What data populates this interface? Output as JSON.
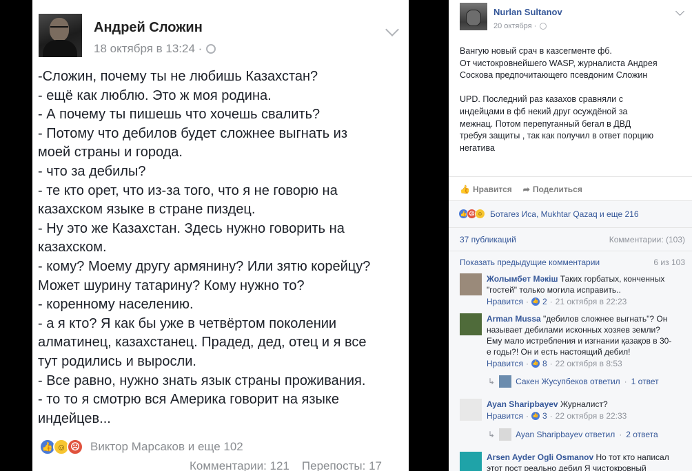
{
  "left_post": {
    "author": "Андрей Сложин",
    "timestamp": "18 октября в 13:24 ·",
    "lines": [
      "-Сложин, почему ты не любишь Казахстан?",
      "- ещё как люблю. Это ж моя родина.",
      "- А почему ты пишешь что хочешь свалить?",
      "- Потому что дебилов будет сложнее выгнать из",
      "моей страны и города.",
      "- что за дебилы?",
      "- те кто орет, что из-за того, что я не говорю на",
      "казахском языке в стране пиздец.",
      "- Ну это же Казахстан. Здесь нужно говорить на",
      "казахском.",
      "- кому? Моему другу армянину? Или зятю корейцу?",
      "Может шурину татарину? Кому нужно то?",
      "- коренному населению.",
      "- а я кто? Я как бы уже в четвёртом поколении",
      "алматинец, казахстанец. Прадед, дед, отец и я все",
      "тут родились и выросли.",
      "- Все равно, нужно знать язык страны проживания.",
      "- то то я смотрю вся Америка говорит на языке",
      "индейцев..."
    ],
    "reactions_text": "Виктор Марсаков и еще 102",
    "comments_text": "Комментарии: 121",
    "reposts_text": "Перепосты: 17"
  },
  "right_post": {
    "author": "Nurlan Sultanov",
    "timestamp": "20 октября ·",
    "text_lines": [
      "Вангую новый срач в казсегменте фб.",
      "От чистокровнейшего WASP, журналиста Андрея",
      "Соскова предпочитающего псевдоним Сложин",
      "",
      "UPD. Последний раз казахов сравняли с",
      "индейцами в фб некий друг осуждёной за",
      "межнац. Потом перепуганный бегал в ДВД",
      "требуя защиты , так как получил в ответ порцию",
      "негатива"
    ],
    "like_label": "Нравится",
    "share_label": "Поделиться",
    "reactions_text": "Ботагез Иса, Mukhtar Qazaq и еще 216",
    "shares_text": "37 публикаций",
    "comments_count_text": "Комментарии: (103)",
    "prev_comments_label": "Показать предыдущие комментарии",
    "pagination_text": "6 из 103",
    "comments": [
      {
        "author": "Жолымбет Мәкіш",
        "lines": [
          "Таких горбатых, конченных",
          "\"гостей\" только могила исправить.."
        ],
        "like_label": "Нравится",
        "likes": "2",
        "time": "21 октября в 22:23"
      },
      {
        "author": "Arman Mussa",
        "lines": [
          "\"дебилов сложнее выгнать\"? Он",
          "называет дебилами исконных хозяев земли?",
          "Ему мало истребления и изгнании қазақов в 30-",
          "е годы?! Он и есть настоящий дебил!"
        ],
        "like_label": "Нравится",
        "likes": "8",
        "time": "22 октября в 8:53",
        "reply": {
          "name": "Сакен Жусупбеков ответил",
          "count": "1 ответ"
        }
      },
      {
        "author": "Ayan Sharipbayev",
        "lines": [
          "Журналист?"
        ],
        "like_label": "Нравится",
        "likes": "3",
        "time": "22 октября в 22:33",
        "reply": {
          "name": "Ayan Sharipbayev ответил",
          "count": "2 ответа"
        }
      },
      {
        "author": "Arsen Ayder Ogli Osmanov",
        "lines": [
          "Но тот кто написал",
          "этот пост реально дебил Я чистокровный"
        ]
      }
    ]
  },
  "colors": {
    "link": "#365899",
    "meta_grey": "#90949c",
    "like_blue": "#4b7bd6",
    "angry_red": "#e0523d",
    "haha_yellow": "#f7c531"
  }
}
